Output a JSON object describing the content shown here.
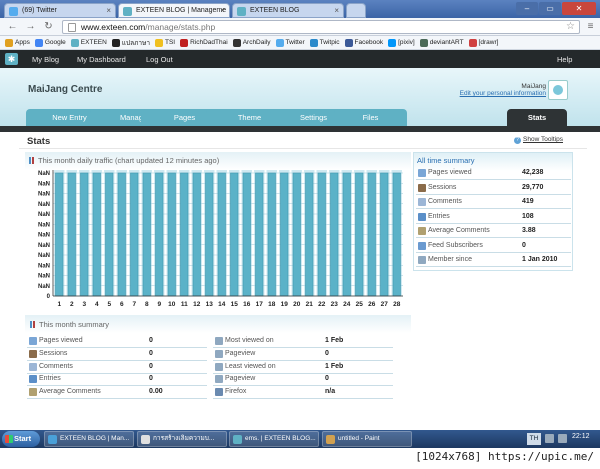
{
  "browser": {
    "tabs": [
      {
        "label": "(69) Twitter",
        "color": "#55acee"
      },
      {
        "label": "EXTEEN BLOG | Manageme",
        "color": "#5fb1c4"
      },
      {
        "label": "EXTEEN BLOG",
        "color": "#5fb1c4"
      }
    ],
    "url_host": "www.exteen.com",
    "url_path": "/manage/stats.php",
    "bookmarks": [
      {
        "label": "Apps",
        "color": "#e0a020"
      },
      {
        "label": "Google",
        "color": "#4285f4"
      },
      {
        "label": "EXTEEN",
        "color": "#5fb1c4"
      },
      {
        "label": "แปลภาษา",
        "color": "#222222"
      },
      {
        "label": "TSI",
        "color": "#f0c020"
      },
      {
        "label": "RichDadThai",
        "color": "#c02020"
      },
      {
        "label": "ArchDaily",
        "color": "#333333"
      },
      {
        "label": "Twitter",
        "color": "#55acee"
      },
      {
        "label": "Twitpic",
        "color": "#2b8acb"
      },
      {
        "label": "Facebook",
        "color": "#3b5998"
      },
      {
        "label": "[pixiv]",
        "color": "#0096fa"
      },
      {
        "label": "deviantART",
        "color": "#4b6a58"
      },
      {
        "label": "[drawr]",
        "color": "#d04040"
      }
    ]
  },
  "site": {
    "nav": [
      "My Blog",
      "My Dashboard",
      "Log Out"
    ],
    "help": "Help",
    "title": "MaiJang Centre",
    "user": "MaiJang",
    "edit_link": "Edit your personal information",
    "tabs": [
      "New Entry",
      "Manage",
      "Pages",
      "Theme",
      "Settings",
      "Files"
    ],
    "active_tab": "Stats",
    "page_title": "Stats",
    "show_tooltips": "Show Tooltips"
  },
  "traffic": {
    "title": "This month daily traffic (chart updated 12 minutes ago)",
    "colors": {
      "bar": "#5bb2c8",
      "bar_edge": "#3d96ad",
      "band": "#cfe9f1"
    }
  },
  "chart_data": {
    "type": "bar",
    "categories": [
      "1",
      "2",
      "3",
      "4",
      "5",
      "6",
      "7",
      "8",
      "9",
      "10",
      "11",
      "12",
      "13",
      "14",
      "15",
      "16",
      "17",
      "18",
      "19",
      "20",
      "21",
      "22",
      "23",
      "24",
      "25",
      "26",
      "27",
      "28"
    ],
    "values": [
      1,
      1,
      1,
      1,
      1,
      1,
      1,
      1,
      1,
      1,
      1,
      1,
      1,
      1,
      1,
      1,
      1,
      1,
      1,
      1,
      1,
      1,
      1,
      1,
      1,
      1,
      1,
      1
    ],
    "y_tick_labels": [
      "NaN",
      "NaN",
      "NaN",
      "NaN",
      "NaN",
      "NaN",
      "NaN",
      "NaN",
      "NaN",
      "NaN",
      "NaN",
      "NaN",
      "0"
    ],
    "title": "This month daily traffic (chart updated 12 minutes ago)",
    "xlabel": "",
    "ylabel": "",
    "grid": true
  },
  "all_time": {
    "title": "All time summary",
    "rows": [
      {
        "label": "Pages viewed",
        "value": "42,238",
        "icon": "page-icon",
        "color": "#7aa6d6"
      },
      {
        "label": "Sessions",
        "value": "29,770",
        "icon": "user-icon",
        "color": "#8a6b4a"
      },
      {
        "label": "Comments",
        "value": "419",
        "icon": "comment-icon",
        "color": "#9cb6d6"
      },
      {
        "label": "Entries",
        "value": "108",
        "icon": "entry-icon",
        "color": "#5b8fc8"
      },
      {
        "label": "Average Comments",
        "value": "3.88",
        "icon": "average-icon",
        "color": "#b0a070"
      },
      {
        "label": "Feed Subscribers",
        "value": "0",
        "icon": "feed-icon",
        "color": "#6a9ad0"
      },
      {
        "label": "Member since",
        "value": "1 Jan 2010",
        "icon": "calendar-icon",
        "color": "#8fa8c0"
      }
    ]
  },
  "month_summary": {
    "title": "This month summary",
    "left": [
      {
        "label": "Pages viewed",
        "value": "0",
        "icon": "page-icon",
        "color": "#7aa6d6"
      },
      {
        "label": "Sessions",
        "value": "0",
        "icon": "user-icon",
        "color": "#8a6b4a"
      },
      {
        "label": "Comments",
        "value": "0",
        "icon": "comment-icon",
        "color": "#9cb6d6"
      },
      {
        "label": "Entries",
        "value": "0",
        "icon": "entry-icon",
        "color": "#5b8fc8"
      },
      {
        "label": "Average Comments",
        "value": "0.00",
        "icon": "average-icon",
        "color": "#b0a070"
      }
    ],
    "right": [
      {
        "label": "Most viewed on",
        "value": "1 Feb",
        "icon": "calendar-icon",
        "color": "#8fa8c0"
      },
      {
        "label": "Pageview",
        "value": "0",
        "icon": "page-icon",
        "color": "#8fa8c0"
      },
      {
        "label": "Least viewed on",
        "value": "1 Feb",
        "icon": "calendar-icon",
        "color": "#8fa8c0"
      },
      {
        "label": "Pageview",
        "value": "0",
        "icon": "page-icon",
        "color": "#8fa8c0"
      },
      {
        "label": "Firefox",
        "value": "n/a",
        "icon": "browser-icon",
        "color": "#6a8ab0"
      }
    ]
  },
  "taskbar": {
    "start": "Start",
    "tasks": [
      {
        "label": "EXTEEN BLOG | Man...",
        "color": "#4aa0d8"
      },
      {
        "label": "การสร้างเลิมความบ...",
        "color": "#e0e0e0"
      },
      {
        "label": "ems. | EXTEEN BLOG...",
        "color": "#5fb1c4"
      },
      {
        "label": "untitled - Paint",
        "color": "#d0a050"
      }
    ],
    "lang": "TH",
    "clock": "22:12"
  },
  "watermark": "[1024x768] https://upic.me/"
}
